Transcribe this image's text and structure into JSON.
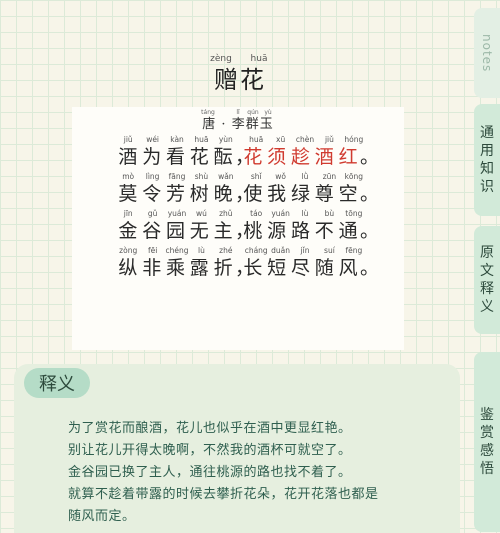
{
  "title": {
    "pinyin": [
      "zèng",
      "huā"
    ],
    "text": "赠花"
  },
  "author": {
    "pinyin": [
      "táng",
      "",
      "lǐ",
      "qún",
      "yù"
    ],
    "text": "唐 · 李群玉"
  },
  "poem": [
    {
      "pinyin": [
        "jiǔ",
        "wéi",
        "kàn",
        "huā",
        "yùn",
        "",
        "huā",
        "xū",
        "chèn",
        "jiǔ",
        "hóng"
      ],
      "chars": [
        "酒",
        "为",
        "看",
        "花",
        "酝",
        "，",
        "花",
        "须",
        "趁",
        "酒",
        "红",
        "。"
      ]
    },
    {
      "pinyin": [
        "mò",
        "lìng",
        "fāng",
        "shù",
        "wǎn",
        "",
        "shǐ",
        "wǒ",
        "lǜ",
        "zūn",
        "kōng"
      ],
      "chars": [
        "莫",
        "令",
        "芳",
        "树",
        "晚",
        "，",
        "使",
        "我",
        "绿",
        "尊",
        "空",
        "。"
      ]
    },
    {
      "pinyin": [
        "jīn",
        "gǔ",
        "yuán",
        "wú",
        "zhǔ",
        "",
        "táo",
        "yuán",
        "lù",
        "bù",
        "tōng"
      ],
      "chars": [
        "金",
        "谷",
        "园",
        "无",
        "主",
        "，",
        "桃",
        "源",
        "路",
        "不",
        "通",
        "。"
      ]
    },
    {
      "pinyin": [
        "zòng",
        "fēi",
        "chéng",
        "lù",
        "zhé",
        "",
        "cháng",
        "duǎn",
        "jǐn",
        "suí",
        "fēng"
      ],
      "chars": [
        "纵",
        "非",
        "乘",
        "露",
        "折",
        "，",
        "长",
        "短",
        "尽",
        "随",
        "风",
        "。"
      ]
    }
  ],
  "notes": {
    "label": "释义",
    "lines": [
      "为了赏花而酿酒，花儿也似乎在酒中更显红艳。",
      "别让花儿开得太晚啊，不然我的酒杯可就空了。",
      "金谷园已换了主人，通往桃源的路也找不着了。",
      "就算不趁着带露的时候去攀折花朵，花开花落也都是",
      "随风而定。"
    ]
  },
  "sidebar": {
    "notes_tab": "notes",
    "tabs": [
      "通用知识",
      "原文释义",
      "鉴赏感悟"
    ]
  },
  "colors": {
    "highlight": "#d03a2f",
    "accent": "#b5dcc7"
  }
}
